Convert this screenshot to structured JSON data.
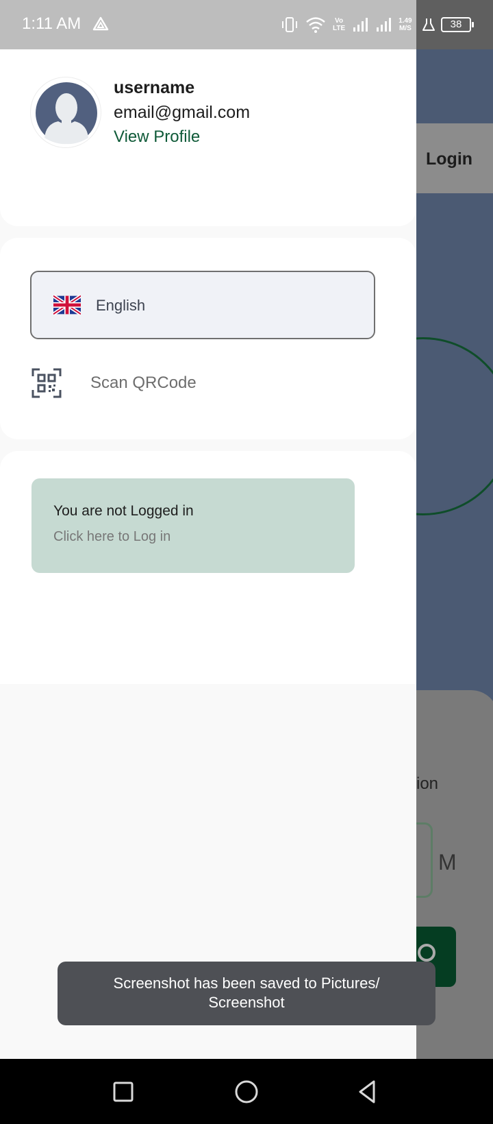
{
  "status_bar": {
    "time": "1:11 AM",
    "network_speed_value": "1.49",
    "network_speed_unit": "M/S",
    "volte_line1": "Vo",
    "volte_line2": "LTE",
    "battery_level": "38"
  },
  "background_app": {
    "login_label": "Login",
    "partial_label": "ion",
    "partial_unit": "M",
    "accent_color": "#053d22"
  },
  "drawer": {
    "profile": {
      "username": "username",
      "email": "email@gmail.com",
      "view_profile_label": "View Profile",
      "link_color": "#0f5a38"
    },
    "language": {
      "label": "English",
      "flag_icon": "uk-flag-icon"
    },
    "scan": {
      "label": "Scan QRCode",
      "icon": "qr-code-icon"
    },
    "login_prompt": {
      "title": "You are not Logged in",
      "subtitle": "Click here to Log in",
      "background_color": "#c6dad2"
    }
  },
  "toast": {
    "message_line1": "Screenshot has been saved to  Pictures/",
    "message_line2": "Screenshot"
  },
  "nav_bar": {
    "icons": [
      "recents-square-icon",
      "home-circle-icon",
      "back-triangle-icon"
    ]
  }
}
